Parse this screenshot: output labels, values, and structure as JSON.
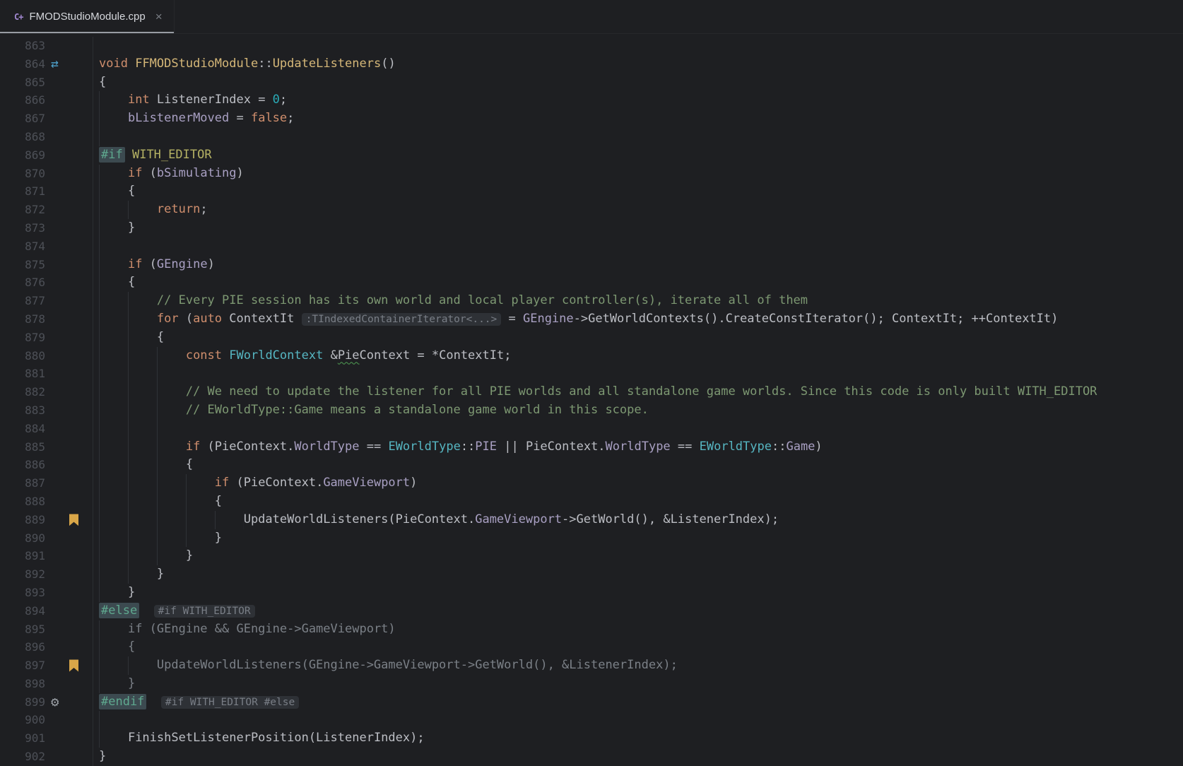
{
  "tab_bar": {
    "tabs": [
      {
        "title": "FMODStudioModule.cpp",
        "icon": "cpp-file-icon",
        "icon_glyph": "C+",
        "close_glyph": "×",
        "active": true
      }
    ]
  },
  "palette": {
    "background": "#1E1F22",
    "default_text": "#BCBEC4",
    "line_number": "#4D5057",
    "keyword": "#CF8E6D",
    "type": "#56B6C2",
    "function": "#D5B778",
    "field": "#A9A0C3",
    "number_literal": "#2AACB8",
    "comment": "#7D9872",
    "directive_text": "#5FA98F",
    "directive_highlight_bg": "#3C4A50",
    "macro": "#B5B264",
    "inactive_code": "#7B8087",
    "inlay_hint_text": "#797E86",
    "inlay_hint_bg": "#2E3136",
    "bookmark_icon": "#D9A648",
    "gear_icon": "#9BA0A6",
    "recursion_icon": "#4FA3CE",
    "active_tab_underline": "#989CA3",
    "typo_squiggle": "#4F9E53"
  },
  "gutter_icons": {
    "recursion": {
      "glyph": "⇄",
      "color": "#4FA3CE"
    },
    "bookmark": {
      "glyph": "",
      "color": "#D9A648"
    },
    "gear": {
      "glyph": "⚙",
      "color": "#9BA0A6"
    }
  },
  "editor": {
    "language": "cpp",
    "first_line": 863,
    "last_line": 902,
    "lines": [
      {
        "num": 863,
        "indent": 0,
        "icon": null,
        "tokens": []
      },
      {
        "num": 864,
        "indent": 0,
        "icon": "recursion",
        "tokens": [
          [
            "kw",
            "void"
          ],
          [
            "tx",
            " "
          ],
          [
            "fn",
            "FFMODStudioModule"
          ],
          [
            "tx",
            "::"
          ],
          [
            "fn",
            "UpdateListeners"
          ],
          [
            "tx",
            "()"
          ]
        ]
      },
      {
        "num": 865,
        "indent": 0,
        "icon": null,
        "tokens": [
          [
            "tx",
            "{"
          ]
        ]
      },
      {
        "num": 866,
        "indent": 1,
        "icon": null,
        "tokens": [
          [
            "kw",
            "int"
          ],
          [
            "tx",
            " ListenerIndex = "
          ],
          [
            "num",
            "0"
          ],
          [
            "tx",
            ";"
          ]
        ]
      },
      {
        "num": 867,
        "indent": 1,
        "icon": null,
        "tokens": [
          [
            "fld",
            "bListenerMoved"
          ],
          [
            "tx",
            " = "
          ],
          [
            "kw",
            "false"
          ],
          [
            "tx",
            ";"
          ]
        ]
      },
      {
        "num": 868,
        "indent": 1,
        "icon": null,
        "tokens": []
      },
      {
        "num": 869,
        "indent": 0,
        "icon": null,
        "tokens": [
          [
            "dir",
            "#if"
          ],
          [
            "tx",
            " "
          ],
          [
            "mac",
            "WITH_EDITOR"
          ]
        ]
      },
      {
        "num": 870,
        "indent": 1,
        "icon": null,
        "tokens": [
          [
            "kw",
            "if"
          ],
          [
            "tx",
            " ("
          ],
          [
            "fld",
            "bSimulating"
          ],
          [
            "tx",
            ")"
          ]
        ]
      },
      {
        "num": 871,
        "indent": 1,
        "icon": null,
        "tokens": [
          [
            "tx",
            "{"
          ]
        ]
      },
      {
        "num": 872,
        "indent": 2,
        "icon": null,
        "tokens": [
          [
            "kw",
            "return"
          ],
          [
            "tx",
            ";"
          ]
        ]
      },
      {
        "num": 873,
        "indent": 1,
        "icon": null,
        "tokens": [
          [
            "tx",
            "}"
          ]
        ]
      },
      {
        "num": 874,
        "indent": 1,
        "icon": null,
        "tokens": []
      },
      {
        "num": 875,
        "indent": 1,
        "icon": null,
        "tokens": [
          [
            "kw",
            "if"
          ],
          [
            "tx",
            " ("
          ],
          [
            "fld",
            "GEngine"
          ],
          [
            "tx",
            ")"
          ]
        ]
      },
      {
        "num": 876,
        "indent": 1,
        "icon": null,
        "tokens": [
          [
            "tx",
            "{"
          ]
        ]
      },
      {
        "num": 877,
        "indent": 2,
        "icon": null,
        "tokens": [
          [
            "cmt",
            "// Every PIE session has its own world and local player controller(s), iterate all of them"
          ]
        ]
      },
      {
        "num": 878,
        "indent": 2,
        "icon": null,
        "tokens": [
          [
            "kw",
            "for"
          ],
          [
            "tx",
            " ("
          ],
          [
            "kw",
            "auto"
          ],
          [
            "tx",
            " ContextIt "
          ],
          [
            "hint",
            ":TIndexedContainerIterator<...>"
          ],
          [
            "tx",
            " = "
          ],
          [
            "fld",
            "GEngine"
          ],
          [
            "tx",
            "->GetWorldContexts().CreateConstIterator(); ContextIt; ++ContextIt)"
          ]
        ]
      },
      {
        "num": 879,
        "indent": 2,
        "icon": null,
        "tokens": [
          [
            "tx",
            "{"
          ]
        ]
      },
      {
        "num": 880,
        "indent": 3,
        "icon": null,
        "tokens": [
          [
            "kw",
            "const"
          ],
          [
            "tx",
            " "
          ],
          [
            "typ",
            "FWorldContext"
          ],
          [
            "tx",
            " &"
          ],
          [
            "typo",
            "Pie"
          ],
          [
            "tx",
            "Context = *ContextIt;"
          ]
        ]
      },
      {
        "num": 881,
        "indent": 3,
        "icon": null,
        "tokens": []
      },
      {
        "num": 882,
        "indent": 3,
        "icon": null,
        "tokens": [
          [
            "cmt",
            "// We need to update the listener for all PIE worlds and all standalone game worlds. Since this code is only built WITH_EDITOR"
          ]
        ]
      },
      {
        "num": 883,
        "indent": 3,
        "icon": null,
        "tokens": [
          [
            "cmt",
            "// EWorldType::Game means a standalone game world in this scope."
          ]
        ]
      },
      {
        "num": 884,
        "indent": 3,
        "icon": null,
        "tokens": []
      },
      {
        "num": 885,
        "indent": 3,
        "icon": null,
        "tokens": [
          [
            "kw",
            "if"
          ],
          [
            "tx",
            " (PieContext."
          ],
          [
            "fld",
            "WorldType"
          ],
          [
            "tx",
            " == "
          ],
          [
            "typ",
            "EWorldType"
          ],
          [
            "tx",
            "::"
          ],
          [
            "fld",
            "PIE"
          ],
          [
            "tx",
            " || PieContext."
          ],
          [
            "fld",
            "WorldType"
          ],
          [
            "tx",
            " == "
          ],
          [
            "typ",
            "EWorldType"
          ],
          [
            "tx",
            "::"
          ],
          [
            "fld",
            "Game"
          ],
          [
            "tx",
            ")"
          ]
        ]
      },
      {
        "num": 886,
        "indent": 3,
        "icon": null,
        "tokens": [
          [
            "tx",
            "{"
          ]
        ]
      },
      {
        "num": 887,
        "indent": 4,
        "icon": null,
        "tokens": [
          [
            "kw",
            "if"
          ],
          [
            "tx",
            " (PieContext."
          ],
          [
            "fld",
            "GameViewport"
          ],
          [
            "tx",
            ")"
          ]
        ]
      },
      {
        "num": 888,
        "indent": 4,
        "icon": null,
        "tokens": [
          [
            "tx",
            "{"
          ]
        ]
      },
      {
        "num": 889,
        "indent": 5,
        "icon": "bookmark",
        "tokens": [
          [
            "tx",
            "UpdateWorldListeners(PieContext."
          ],
          [
            "fld",
            "GameViewport"
          ],
          [
            "tx",
            "->GetWorld(), &ListenerIndex);"
          ]
        ]
      },
      {
        "num": 890,
        "indent": 4,
        "icon": null,
        "tokens": [
          [
            "tx",
            "}"
          ]
        ]
      },
      {
        "num": 891,
        "indent": 3,
        "icon": null,
        "tokens": [
          [
            "tx",
            "}"
          ]
        ]
      },
      {
        "num": 892,
        "indent": 2,
        "icon": null,
        "tokens": [
          [
            "tx",
            "}"
          ]
        ]
      },
      {
        "num": 893,
        "indent": 1,
        "icon": null,
        "tokens": [
          [
            "tx",
            "}"
          ]
        ]
      },
      {
        "num": 894,
        "indent": 0,
        "icon": null,
        "tokens": [
          [
            "dir",
            "#else"
          ],
          [
            "tx",
            "  "
          ],
          [
            "hint",
            "#if WITH_EDITOR"
          ]
        ]
      },
      {
        "num": 895,
        "indent": 1,
        "icon": null,
        "tokens": [
          [
            "ina",
            "if (GEngine && GEngine->GameViewport)"
          ]
        ]
      },
      {
        "num": 896,
        "indent": 1,
        "icon": null,
        "tokens": [
          [
            "ina",
            "{"
          ]
        ]
      },
      {
        "num": 897,
        "indent": 2,
        "icon": "bookmark",
        "tokens": [
          [
            "ina",
            "UpdateWorldListeners(GEngine->GameViewport->GetWorld(), &ListenerIndex);"
          ]
        ]
      },
      {
        "num": 898,
        "indent": 1,
        "icon": null,
        "tokens": [
          [
            "ina",
            "}"
          ]
        ]
      },
      {
        "num": 899,
        "indent": 0,
        "icon": "gear",
        "tokens": [
          [
            "dir",
            "#endif"
          ],
          [
            "tx",
            "  "
          ],
          [
            "hint",
            "#if WITH_EDITOR #else"
          ]
        ]
      },
      {
        "num": 900,
        "indent": 1,
        "icon": null,
        "tokens": []
      },
      {
        "num": 901,
        "indent": 1,
        "icon": null,
        "tokens": [
          [
            "tx",
            "FinishSetListenerPosition(ListenerIndex);"
          ]
        ]
      },
      {
        "num": 902,
        "indent": 0,
        "icon": null,
        "tokens": [
          [
            "tx",
            "}"
          ]
        ]
      }
    ]
  }
}
